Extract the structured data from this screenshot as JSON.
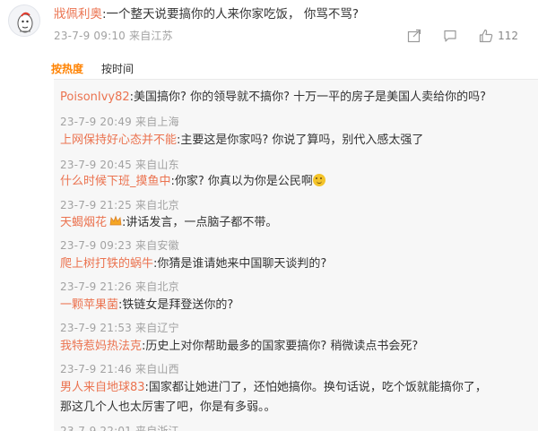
{
  "post": {
    "username": "戕佩利奥",
    "text": ":一个整天说要搞你的人来你家吃饭， 你骂不骂?",
    "meta": "23-7-9 09:10 来自江苏",
    "icons": [
      "share-icon",
      "comment-icon",
      "thumbs-up-icon"
    ],
    "like_count": "112"
  },
  "sort": {
    "hot": "按热度",
    "time": "按时间"
  },
  "colors": {
    "username": "#eb7350",
    "active_tab": "#ff8200",
    "meta": "#a2a2a2",
    "reply_bg": "#f7f7f7"
  },
  "replies": [
    {
      "user": "PoisonIvy82",
      "text": ":美国搞你? 你的领导就不搞你? 十万一平的房子是美国人卖给你的吗?",
      "meta": "23-7-9 20:49 来自上海"
    },
    {
      "user": "上网保持好心态并不能",
      "text": ":主要这是你家吗? 你说了算吗，别代入感太强了",
      "meta": "23-7-9 20:45 来自山东"
    },
    {
      "user": "什么时候下班_摸鱼中",
      "text": ":你家? 你真以为你是公民啊",
      "meta": "23-7-9 21:25 来自北京"
    },
    {
      "user": "天蝎烟花",
      "text": ":讲话发言，一点脑子都不带。",
      "meta": "23-7-9 09:23 来自安徽"
    },
    {
      "user": "爬上树打铁的蜗牛",
      "text": ":你猜是谁请她来中国聊天谈判的?",
      "meta": "23-7-9 21:26 来自北京"
    },
    {
      "user": "一颗苹果菌",
      "text": ":铁链女是拜登送你的?",
      "meta": "23-7-9 21:53 来自辽宁"
    },
    {
      "user": "我特惹妈热法克",
      "text": ":历史上对你帮助最多的国家要搞你? 稍微读点书会死?",
      "meta": "23-7-9 21:46 来自山西"
    },
    {
      "user": "男人来自地球83",
      "text": ":国家都让她进门了，还怕她搞你。换句话说，吃个饭就能搞你了，",
      "text2": "那这几个人也太厉害了吧，你是有多弱。。",
      "meta": "23-7-9 22:01 来自浙江"
    }
  ]
}
